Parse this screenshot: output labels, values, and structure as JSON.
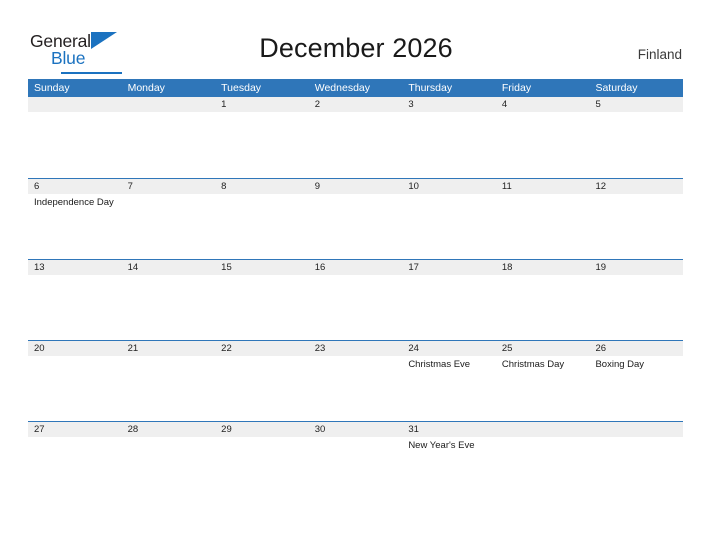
{
  "brand": {
    "name_dark": "General",
    "name_blue": "Blue",
    "flag_icon": "triangle-flag-icon",
    "accent_color": "#1b72c0"
  },
  "header": {
    "title": "December 2026",
    "country": "Finland"
  },
  "calendar": {
    "header_bg_color": "#2f76b9",
    "day_band_color": "#efefef",
    "weekdays": [
      "Sunday",
      "Monday",
      "Tuesday",
      "Wednesday",
      "Thursday",
      "Friday",
      "Saturday"
    ],
    "weeks": [
      [
        {
          "day": "",
          "events": []
        },
        {
          "day": "",
          "events": []
        },
        {
          "day": "1",
          "events": []
        },
        {
          "day": "2",
          "events": []
        },
        {
          "day": "3",
          "events": []
        },
        {
          "day": "4",
          "events": []
        },
        {
          "day": "5",
          "events": []
        }
      ],
      [
        {
          "day": "6",
          "events": [
            "Independence Day"
          ]
        },
        {
          "day": "7",
          "events": []
        },
        {
          "day": "8",
          "events": []
        },
        {
          "day": "9",
          "events": []
        },
        {
          "day": "10",
          "events": []
        },
        {
          "day": "11",
          "events": []
        },
        {
          "day": "12",
          "events": []
        }
      ],
      [
        {
          "day": "13",
          "events": []
        },
        {
          "day": "14",
          "events": []
        },
        {
          "day": "15",
          "events": []
        },
        {
          "day": "16",
          "events": []
        },
        {
          "day": "17",
          "events": []
        },
        {
          "day": "18",
          "events": []
        },
        {
          "day": "19",
          "events": []
        }
      ],
      [
        {
          "day": "20",
          "events": []
        },
        {
          "day": "21",
          "events": []
        },
        {
          "day": "22",
          "events": []
        },
        {
          "day": "23",
          "events": []
        },
        {
          "day": "24",
          "events": [
            "Christmas Eve"
          ]
        },
        {
          "day": "25",
          "events": [
            "Christmas Day"
          ]
        },
        {
          "day": "26",
          "events": [
            "Boxing Day"
          ]
        }
      ],
      [
        {
          "day": "27",
          "events": []
        },
        {
          "day": "28",
          "events": []
        },
        {
          "day": "29",
          "events": []
        },
        {
          "day": "30",
          "events": []
        },
        {
          "day": "31",
          "events": [
            "New Year's Eve"
          ]
        },
        {
          "day": "",
          "events": []
        },
        {
          "day": "",
          "events": []
        }
      ]
    ]
  }
}
